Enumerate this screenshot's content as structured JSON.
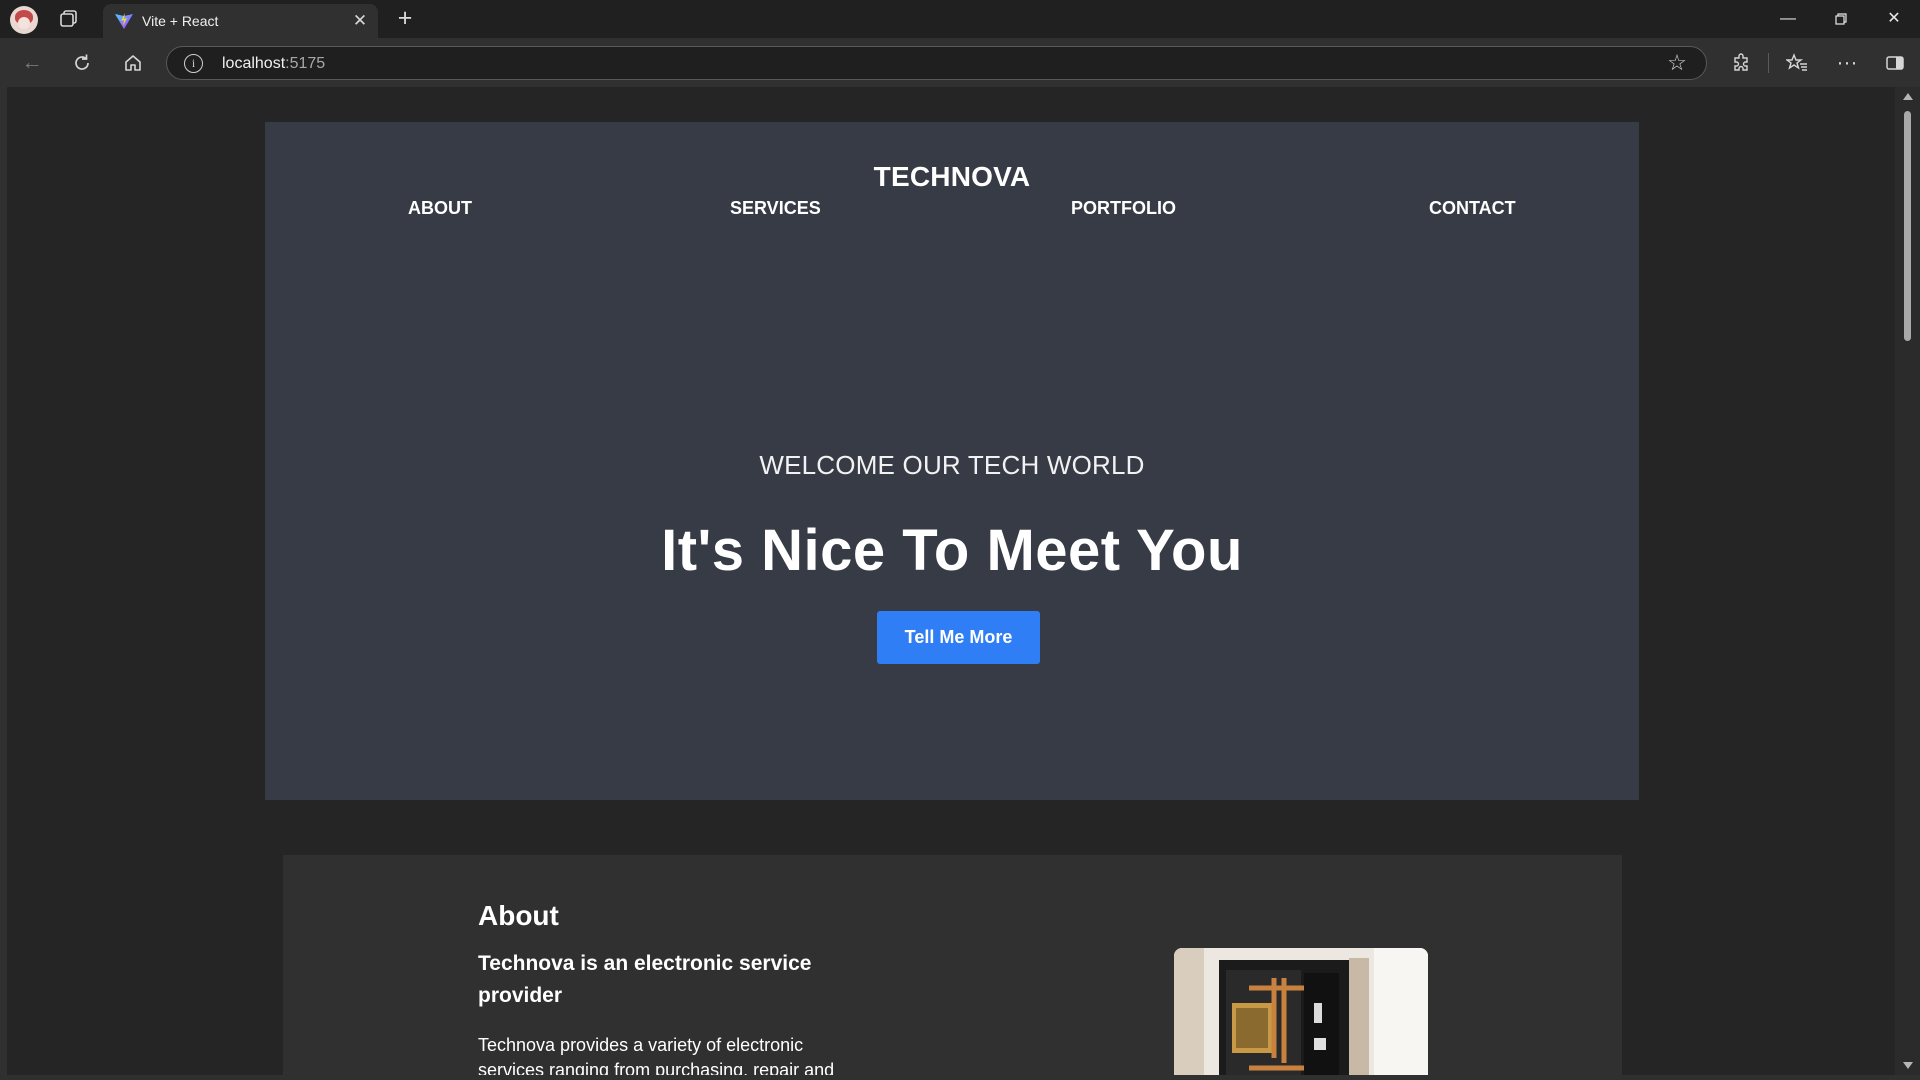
{
  "browser": {
    "tab_title": "Vite + React",
    "url_host": "localhost",
    "url_port": ":5175"
  },
  "site": {
    "brand": "TECHNOVA",
    "nav": [
      {
        "label": "ABOUT"
      },
      {
        "label": "SERVICES"
      },
      {
        "label": "PORTFOLIO"
      },
      {
        "label": "CONTACT"
      }
    ],
    "hero": {
      "tagline": "WELCOME OUR TECH WORLD",
      "headline": "It's Nice To Meet You",
      "cta_label": "Tell Me More",
      "background_color": "#363b45",
      "cta_color": "#2f7ef6"
    },
    "about": {
      "title": "About",
      "subtitle": "Technova is an electronic service provider",
      "text": "Technova provides a variety of electronic services ranging from purchasing, repair and"
    }
  }
}
